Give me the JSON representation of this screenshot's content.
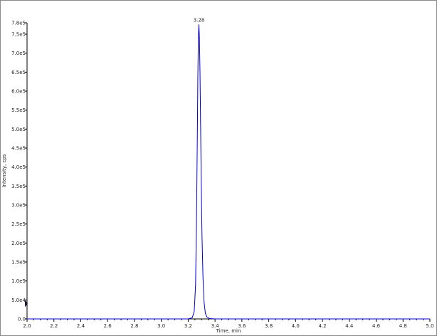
{
  "chart_data": {
    "type": "line",
    "title": "",
    "xlabel": "Time, min",
    "ylabel": "Intensity, cps",
    "xlim": [
      2.0,
      5.0
    ],
    "ylim": [
      0,
      780000
    ],
    "x_ticks": [
      "2.0",
      "2.2",
      "2.4",
      "2.6",
      "2.8",
      "3.0",
      "3.2",
      "3.4",
      "3.6",
      "3.8",
      "4.0",
      "4.2",
      "4.4",
      "4.6",
      "4.8",
      "5.0"
    ],
    "y_ticks": [
      {
        "value": 0,
        "label": "0.0"
      },
      {
        "value": 50000,
        "label": "5.0e4"
      },
      {
        "value": 100000,
        "label": "1.0e5"
      },
      {
        "value": 150000,
        "label": "1.5e5"
      },
      {
        "value": 200000,
        "label": "2.0e5"
      },
      {
        "value": 250000,
        "label": "2.5e5"
      },
      {
        "value": 300000,
        "label": "3.0e5"
      },
      {
        "value": 350000,
        "label": "3.5e5"
      },
      {
        "value": 400000,
        "label": "4.0e5"
      },
      {
        "value": 450000,
        "label": "4.5e5"
      },
      {
        "value": 500000,
        "label": "5.0e5"
      },
      {
        "value": 550000,
        "label": "5.5e5"
      },
      {
        "value": 600000,
        "label": "6.0e5"
      },
      {
        "value": 650000,
        "label": "6.5e5"
      },
      {
        "value": 700000,
        "label": "7.0e5"
      },
      {
        "value": 750000,
        "label": "7.5e5"
      },
      {
        "value": 780000,
        "label": "7.8e5"
      }
    ],
    "grid": false,
    "series": [
      {
        "color": "#0000cc",
        "x": [
          2.0,
          3.2,
          3.23,
          3.245,
          3.255,
          3.262,
          3.268,
          3.272,
          3.276,
          3.28,
          3.284,
          3.288,
          3.292,
          3.297,
          3.303,
          3.31,
          3.318,
          3.328,
          3.34,
          3.36,
          3.4,
          5.0
        ],
        "y": [
          0,
          0,
          3000,
          20000,
          90000,
          260000,
          470000,
          640000,
          740000,
          775000,
          740000,
          650000,
          520000,
          370000,
          220000,
          110000,
          45000,
          15000,
          5000,
          1000,
          0,
          0
        ]
      }
    ],
    "annotations": [
      {
        "text": "3.28",
        "x": 3.28,
        "y": 775000
      }
    ]
  }
}
